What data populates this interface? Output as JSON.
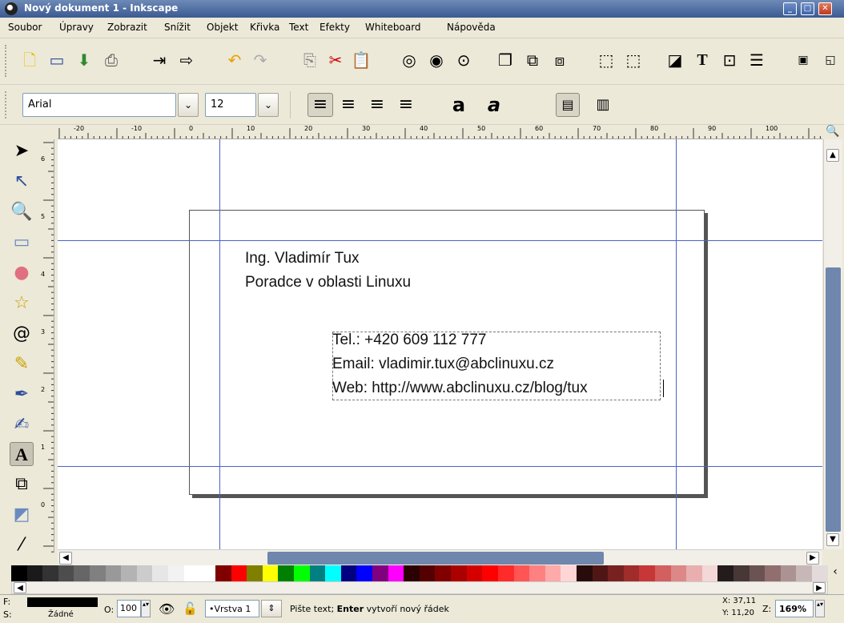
{
  "window": {
    "title": "Nový dokument 1 - Inkscape"
  },
  "menu": [
    "Soubor",
    "Úpravy",
    "Zobrazit",
    "Snížit",
    "Objekt",
    "Křivka",
    "Text",
    "Efekty",
    "Whiteboard",
    "Nápověda"
  ],
  "text_toolbar": {
    "font_family": "Arial",
    "font_size": "12"
  },
  "document": {
    "heading_lines": [
      "Ing. Vladimír Tux",
      "Poradce v oblasti Linuxu"
    ],
    "contact_lines": [
      "Tel.: +420 609 112 777",
      "Email: vladimir.tux@abclinuxu.cz",
      "Web: http://www.abclinuxu.cz/blog/tux"
    ]
  },
  "rulers": {
    "horizontal_labels": [
      "-20",
      "-10",
      "0",
      "10",
      "20",
      "30",
      "40",
      "50",
      "60",
      "70",
      "80",
      "90",
      "100"
    ],
    "vertical_labels": [
      "6",
      "5",
      "4",
      "3",
      "2",
      "1",
      "0"
    ]
  },
  "status": {
    "fill_label": "F:",
    "stroke_label": "S:",
    "stroke_value": "Žádné",
    "opacity_label": "O:",
    "opacity_value": "100",
    "layer": "•Vrstva 1",
    "message_prefix": "Pište text;",
    "message_bold": "Enter",
    "message_suffix": "vytvoří nový řádek",
    "x_label": "X:",
    "x_value": "37,11",
    "y_label": "Y:",
    "y_value": "11,20",
    "zoom_label": "Z:",
    "zoom_value": "169%"
  },
  "palette": [
    "#000000",
    "#1a1a1a",
    "#333333",
    "#4d4d4d",
    "#666666",
    "#808080",
    "#999999",
    "#b3b3b3",
    "#cccccc",
    "#e6e6e6",
    "#f2f2f2",
    "#ffffff",
    "#ffffff",
    "#800000",
    "#ff0000",
    "#808000",
    "#ffff00",
    "#008000",
    "#00ff00",
    "#008080",
    "#00ffff",
    "#000080",
    "#0000ff",
    "#800080",
    "#ff00ff",
    "#2b0000",
    "#550000",
    "#800000",
    "#aa0000",
    "#d40000",
    "#ff0000",
    "#ff2a2a",
    "#ff5555",
    "#ff8080",
    "#ffaaaa",
    "#ffd5d5",
    "#280b0b",
    "#501616",
    "#782121",
    "#a02c2c",
    "#c83737",
    "#d35f5f",
    "#de8787",
    "#e9afaf",
    "#f4d7d7",
    "#241c1c",
    "#483737",
    "#6c5353",
    "#916f6f",
    "#ac9393",
    "#c8b7b7",
    "#e3dbdb"
  ]
}
